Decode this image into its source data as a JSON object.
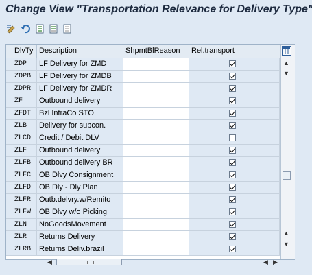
{
  "window": {
    "title": "Change View \"Transportation Relevance for Delivery Type\":"
  },
  "toolbar": {
    "icons": [
      "change-display-icon",
      "undo-icon",
      "select-all-icon",
      "select-block-icon",
      "deselect-all-icon"
    ]
  },
  "table": {
    "columns": [
      "DlvTy",
      "Description",
      "ShpmtBlReason",
      "Rel.transport"
    ],
    "rows": [
      {
        "key": "ZDP",
        "desc": "LF Delivery for ZMD",
        "reason": "",
        "rel": true
      },
      {
        "key": "ZDPB",
        "desc": "LF Delivery for ZMDB",
        "reason": "",
        "rel": true
      },
      {
        "key": "ZDPR",
        "desc": "LF Delivery for ZMDR",
        "reason": "",
        "rel": true
      },
      {
        "key": "ZF",
        "desc": "Outbound delivery",
        "reason": "",
        "rel": true
      },
      {
        "key": "ZFDT",
        "desc": "Bzl IntraCo STO",
        "reason": "",
        "rel": true
      },
      {
        "key": "ZLB",
        "desc": "Delivery for subcon.",
        "reason": "",
        "rel": true
      },
      {
        "key": "ZLCD",
        "desc": "Credit / Debit DLV",
        "reason": "",
        "rel": false
      },
      {
        "key": "ZLF",
        "desc": "Outbound delivery",
        "reason": "",
        "rel": true
      },
      {
        "key": "ZLFB",
        "desc": "Outbound delivery BR",
        "reason": "",
        "rel": true
      },
      {
        "key": "ZLFC",
        "desc": "OB Dlvy Consignment",
        "reason": "",
        "rel": true
      },
      {
        "key": "ZLFD",
        "desc": "OB Dly - Dly Plan",
        "reason": "",
        "rel": true
      },
      {
        "key": "ZLFR",
        "desc": "Outb.delvry.w/Remito",
        "reason": "",
        "rel": true
      },
      {
        "key": "ZLFW",
        "desc": "OB Dlvy w/o Picking",
        "reason": "",
        "rel": true
      },
      {
        "key": "ZLN",
        "desc": "NoGoodsMovement",
        "reason": "",
        "rel": true
      },
      {
        "key": "ZLR",
        "desc": "Returns Delivery",
        "reason": "",
        "rel": true
      },
      {
        "key": "ZLRB",
        "desc": "Returns Deliv.brazil",
        "reason": "",
        "rel": true
      }
    ]
  },
  "colors": {
    "background": "#dfe9f4",
    "header": "#e3ebf3",
    "grid": "#c7d2de",
    "title": "#1d2a3f"
  }
}
